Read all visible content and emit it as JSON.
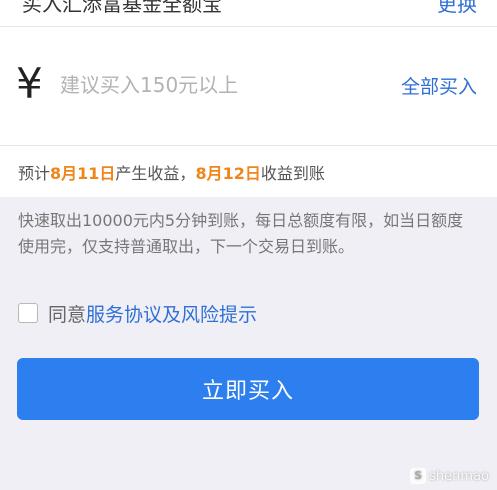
{
  "fund": {
    "name": "买入汇添富基金全额宝",
    "switch_label": "更换"
  },
  "amount": {
    "currency_symbol": "¥",
    "placeholder": "建议买入150元以上",
    "buy_all_label": "全部买入"
  },
  "income": {
    "prefix": "预计",
    "start_date": "8月11日",
    "middle": "产生收益，",
    "arrival_date": "8月12日",
    "suffix": "收益到账"
  },
  "notice": {
    "text": "快速取出10000元内5分钟到账，每日总额度有限，如当日额度使用完，仅支持普通取出，下一个交易日到账。"
  },
  "agreement": {
    "prefix": "同意",
    "link_text": "服务协议及风险提示",
    "checked": false
  },
  "buy_button": {
    "label": "立即买入",
    "color": "#2d7ff0"
  },
  "watermark": {
    "icon": "S",
    "text": "shenmao"
  },
  "colors": {
    "accent": "#2f6fd6",
    "highlight": "#f08519"
  }
}
